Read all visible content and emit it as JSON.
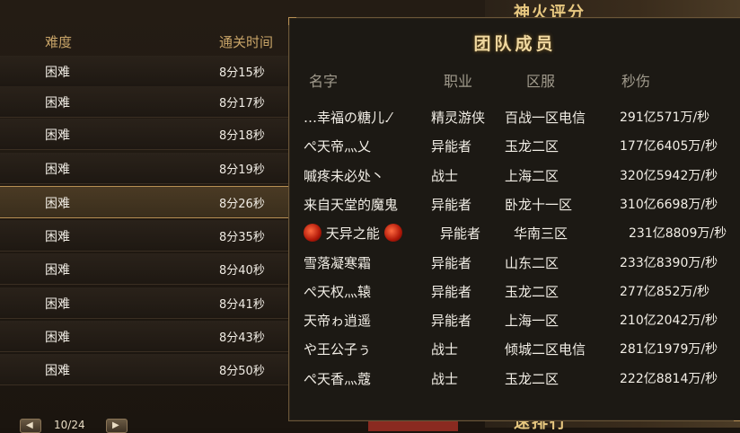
{
  "list": {
    "headers": {
      "difficulty": "难度",
      "clear_time": "通关时间"
    },
    "rows": [
      {
        "difficulty": "困难",
        "time": "8分15秒"
      },
      {
        "difficulty": "困难",
        "time": "8分17秒"
      },
      {
        "difficulty": "困难",
        "time": "8分18秒"
      },
      {
        "difficulty": "困难",
        "time": "8分19秒"
      },
      {
        "difficulty": "困难",
        "time": "8分26秒"
      },
      {
        "difficulty": "困难",
        "time": "8分35秒"
      },
      {
        "difficulty": "困难",
        "time": "8分40秒"
      },
      {
        "difficulty": "困难",
        "time": "8分41秒"
      },
      {
        "difficulty": "困难",
        "time": "8分43秒"
      },
      {
        "difficulty": "困难",
        "time": "8分50秒"
      }
    ],
    "page_indicator": "10/24"
  },
  "deco": {
    "top_label": "神火评分",
    "bottom_label": "速排行"
  },
  "popup": {
    "title": "团队成员",
    "headers": {
      "name": "名字",
      "job": "职业",
      "server": "区服",
      "dps": "秒伤"
    },
    "members": [
      {
        "name": "…幸福の糖儿.⁄",
        "job": "精灵游侠",
        "server": "百战一区电信",
        "dps": "291亿571万/秒"
      },
      {
        "name": "ぺ天帝灬乂",
        "job": "异能者",
        "server": "玉龙二区",
        "dps": "177亿6405万/秒"
      },
      {
        "name": "嘁疼未必处丶",
        "job": "战士",
        "server": "上海二区",
        "dps": "320亿5942万/秒"
      },
      {
        "name": "来自天堂的魔鬼",
        "job": "异能者",
        "server": "卧龙十一区",
        "dps": "310亿6698万/秒"
      },
      {
        "name": "天异之能",
        "job": "异能者",
        "server": "华南三区",
        "dps": "231亿8809万/秒"
      },
      {
        "name": "雪落凝寒霜",
        "job": "异能者",
        "server": "山东二区",
        "dps": "233亿8390万/秒"
      },
      {
        "name": "ぺ天权灬辕",
        "job": "异能者",
        "server": "玉龙二区",
        "dps": "277亿852万/秒"
      },
      {
        "name": "天帝ゎ逍遥",
        "job": "异能者",
        "server": "上海一区",
        "dps": "210亿2042万/秒"
      },
      {
        "name": "や王公子ぅ",
        "job": "战士",
        "server": "倾城二区电信",
        "dps": "281亿1979万/秒"
      },
      {
        "name": "ぺ天香灬蔻",
        "job": "战士",
        "server": "玉龙二区",
        "dps": "222亿8814万/秒"
      }
    ]
  }
}
